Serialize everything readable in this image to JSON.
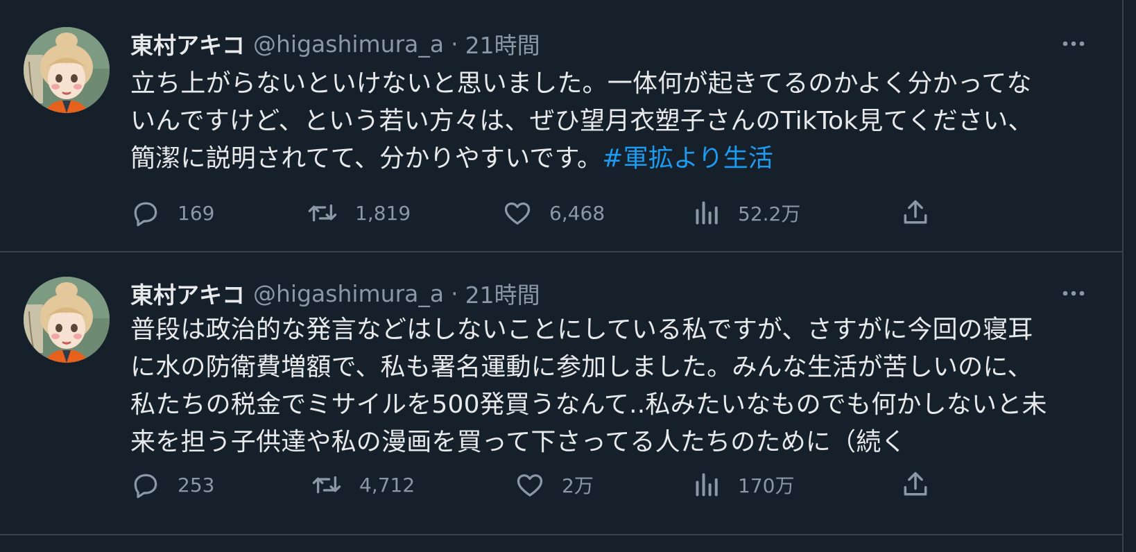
{
  "colors": {
    "background": "#15202b",
    "text": "#e7e9ea",
    "secondary": "#8b98a5",
    "link": "#1d9bf0",
    "border": "#38444d"
  },
  "icons": {
    "reply": "speech-bubble-icon",
    "retweet": "retweet-arrows-icon",
    "like": "heart-icon",
    "views": "bar-chart-icon",
    "share": "share-upload-icon",
    "more": "more-dots-icon"
  },
  "tweets": [
    {
      "author": {
        "name": "東村アキコ",
        "handle": "@higashimura_a"
      },
      "separator": "·",
      "time": "21時間",
      "lines": [
        "立ち上がらないといけないと思いました。一体何が起きてるのかよく分かってな",
        "いんですけど、という若い方々は、ぜひ望月衣塑子さんのTikTok見てください、",
        "簡潔に説明されてて、分かりやすいです。"
      ],
      "hashtag": "#軍拡より生活",
      "stats": {
        "replies": "169",
        "retweets": "1,819",
        "likes": "6,468",
        "views": "52.2万"
      }
    },
    {
      "author": {
        "name": "東村アキコ",
        "handle": "@higashimura_a"
      },
      "separator": "·",
      "time": "21時間",
      "lines": [
        "普段は政治的な発言などはしないことにしている私ですが、さすがに今回の寝耳",
        "に水の防衛費増額で、私も署名運動に参加しました。みんな生活が苦しいのに、",
        "私たちの税金でミサイルを500発買うなんて..私みたいなものでも何かしないと未",
        "来を担う子供達や私の漫画を買って下さってる人たちのために（続く"
      ],
      "stats": {
        "replies": "253",
        "retweets": "4,712",
        "likes": "2万",
        "views": "170万"
      }
    }
  ]
}
